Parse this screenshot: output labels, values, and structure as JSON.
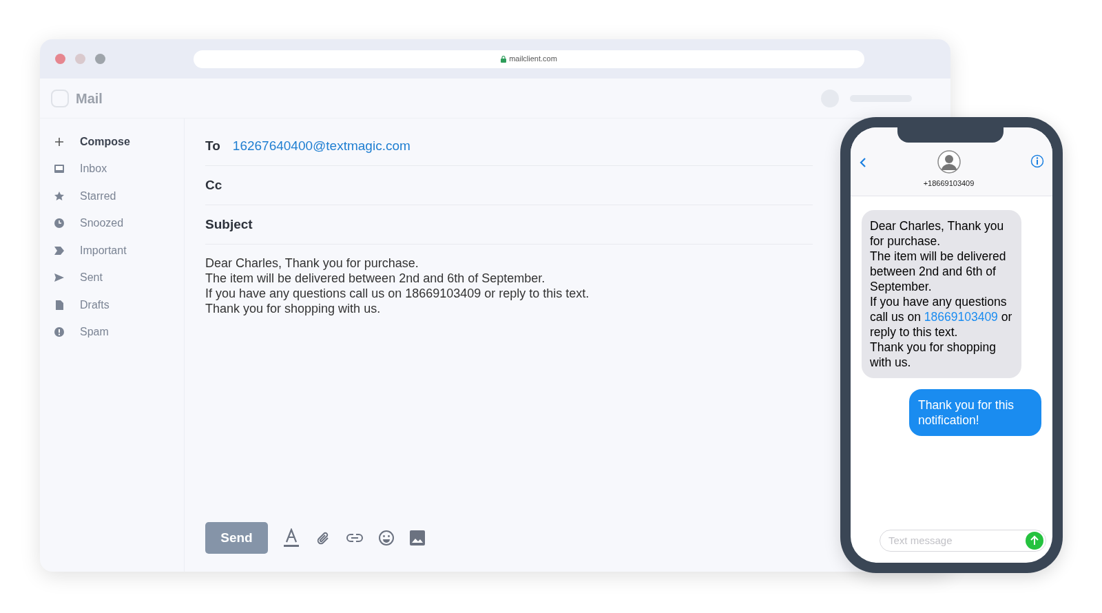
{
  "browser": {
    "address": "mailclient.com"
  },
  "app": {
    "title": "Mail"
  },
  "sidebar": {
    "items": [
      {
        "label": "Compose",
        "kind": "compose"
      },
      {
        "label": "Inbox",
        "kind": "inbox"
      },
      {
        "label": "Starred",
        "kind": "starred"
      },
      {
        "label": "Snoozed",
        "kind": "snoozed"
      },
      {
        "label": "Important",
        "kind": "important"
      },
      {
        "label": "Sent",
        "kind": "sent"
      },
      {
        "label": "Drafts",
        "kind": "drafts"
      },
      {
        "label": "Spam",
        "kind": "spam"
      }
    ]
  },
  "compose": {
    "fields": [
      {
        "label": "To",
        "value": "16267640400@textmagic.com"
      },
      {
        "label": "Cc"
      },
      {
        "label": "Subject"
      }
    ],
    "body": [
      "Dear Charles, Thank you for purchase.",
      "The item will be delivered between 2nd and 6th of September.",
      "If you have any questions call us on 18669103409 or reply to this text.",
      "Thank you for shopping with us."
    ],
    "send_button": "Send"
  },
  "phone": {
    "contact": "+18669103409",
    "messages": [
      {
        "kind": "incoming",
        "parts": [
          {
            "text": "Dear Charles, Thank you for purchase.\nThe item will be delivered between 2nd and 6th of September.\nIf you have any questions call us on "
          },
          {
            "text": "18669103409",
            "kind": "link"
          },
          {
            "text": " or reply to this text.\nThank you for shopping with us."
          }
        ]
      },
      {
        "kind": "outgoing",
        "parts": [
          {
            "text": "Thank you for this notification!"
          }
        ]
      }
    ],
    "input": {
      "placeholder": "Text message"
    }
  }
}
